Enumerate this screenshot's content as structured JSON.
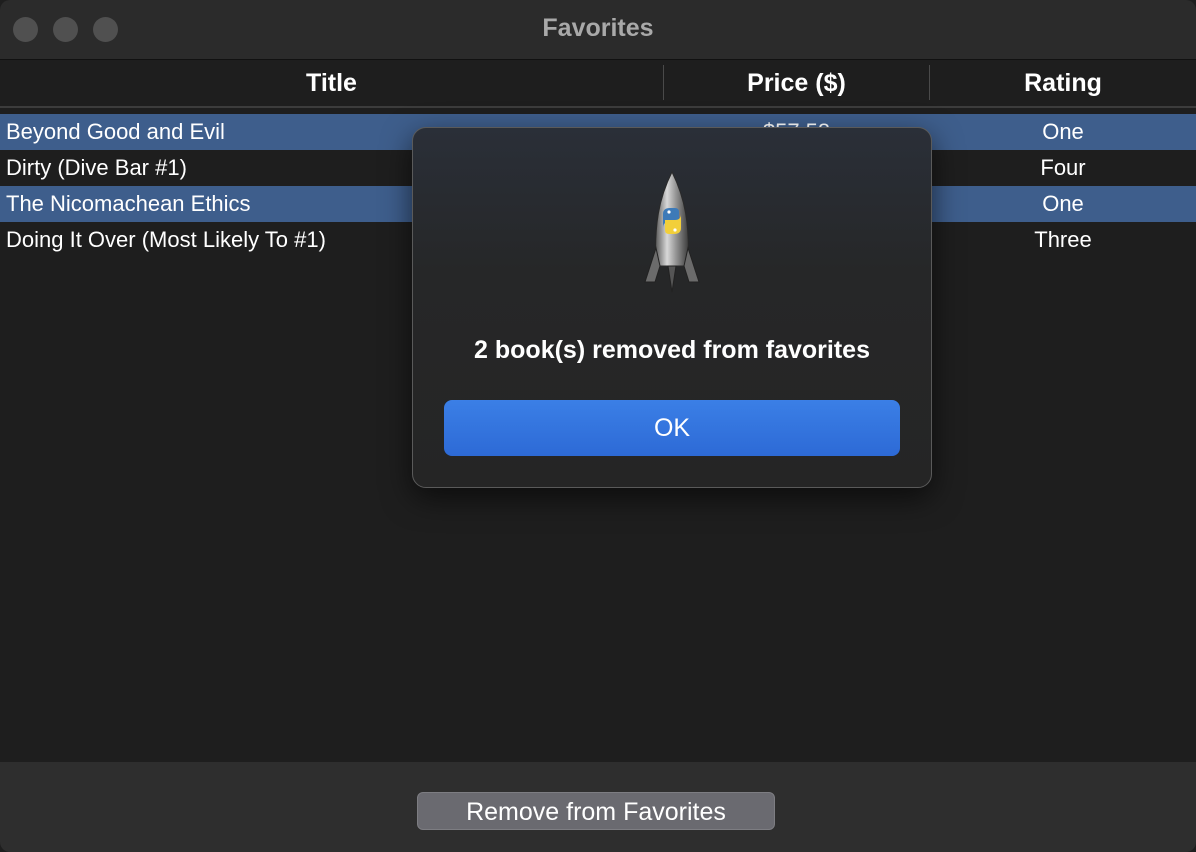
{
  "window": {
    "title": "Favorites"
  },
  "table": {
    "columns": [
      "Title",
      "Price ($)",
      "Rating"
    ],
    "rows": [
      {
        "title": "Beyond Good and Evil",
        "price": "$57.58",
        "rating": "One",
        "selected": true
      },
      {
        "title": "Dirty (Dive Bar #1)",
        "price": "",
        "rating": "Four",
        "selected": false
      },
      {
        "title": "The Nicomachean Ethics",
        "price": "",
        "rating": "One",
        "selected": true
      },
      {
        "title": "Doing It Over (Most Likely To #1)",
        "price": "",
        "rating": "Three",
        "selected": false
      }
    ]
  },
  "footer": {
    "remove_label": "Remove from Favorites"
  },
  "alert": {
    "icon": "python-rocket-icon",
    "message": "2 book(s) removed from favorites",
    "ok_label": "OK"
  },
  "colors": {
    "selection": "#3e5e8c",
    "accent_button": "#3b7fe6",
    "background": "#1e1e1e"
  }
}
